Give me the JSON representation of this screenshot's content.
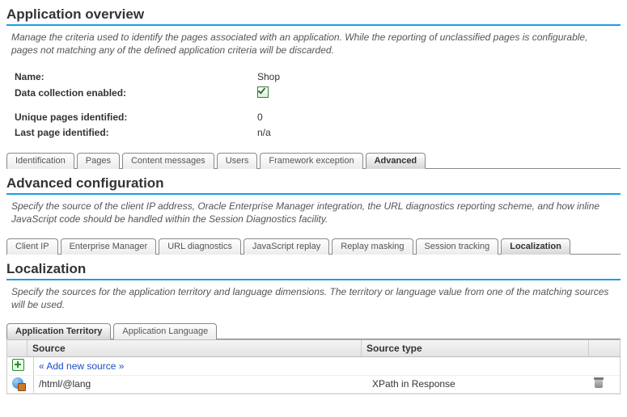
{
  "overview": {
    "title": "Application overview",
    "description": "Manage the criteria used to identify the pages associated with an application. While the reporting of unclassified pages is configurable, pages not matching any of the defined application criteria will be discarded.",
    "fields": {
      "name_label": "Name:",
      "name_value": "Shop",
      "data_collection_label": "Data collection enabled:",
      "unique_pages_label": "Unique pages identified:",
      "unique_pages_value": "0",
      "last_page_label": "Last page identified:",
      "last_page_value": "n/a"
    }
  },
  "main_tabs": {
    "items": [
      "Identification",
      "Pages",
      "Content messages",
      "Users",
      "Framework exception",
      "Advanced"
    ],
    "active": 5
  },
  "advanced": {
    "title": "Advanced configuration",
    "description": "Specify the source of the client IP address, Oracle Enterprise Manager integration, the URL diagnostics reporting scheme, and how inline JavaScript code should be handled within the Session Diagnostics facility."
  },
  "advanced_tabs": {
    "items": [
      "Client IP",
      "Enterprise Manager",
      "URL diagnostics",
      "JavaScript replay",
      "Replay masking",
      "Session tracking",
      "Localization"
    ],
    "active": 6
  },
  "localization": {
    "title": "Localization",
    "description": "Specify the sources for the application territory and language dimensions. The territory or language value from one of the matching sources will be used."
  },
  "loc_tabs": {
    "items": [
      "Application Territory",
      "Application Language"
    ],
    "active": 0
  },
  "table": {
    "columns": {
      "source": "Source",
      "type": "Source type"
    },
    "add_link": "« Add new source »",
    "rows": [
      {
        "source": "/html/@lang",
        "type": "XPath in Response"
      }
    ]
  }
}
